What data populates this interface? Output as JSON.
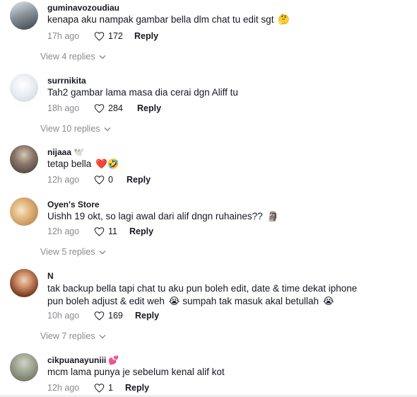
{
  "comments": [
    {
      "username": "guminavozoudiau",
      "username_emoji": "",
      "text": "kenapa aku nampak gambar bella dlm chat tu edit sgt",
      "text_emoji": "🤔",
      "time": "17h ago",
      "likes": "172",
      "reply_label": "Reply",
      "view_replies": "View 4 replies"
    },
    {
      "username": "surrnikita",
      "username_emoji": "",
      "text": "Tah2 gambar lama masa dia cerai dgn Aliff tu",
      "text_emoji": "",
      "time": "18h ago",
      "likes": "284",
      "reply_label": "Reply",
      "view_replies": "View 10 replies"
    },
    {
      "username": "nijaaa",
      "username_emoji": "🕊️",
      "text": "tetap bella",
      "text_emoji": "❤️🤣",
      "time": "12h ago",
      "likes": "0",
      "reply_label": "Reply",
      "view_replies": ""
    },
    {
      "username": "Oyen's Store",
      "username_emoji": "",
      "text": "Uishh 19 okt, so lagi awal dari alif dngn ruhaines??",
      "text_emoji": "🗿",
      "time": "12h ago",
      "likes": "11",
      "reply_label": "Reply",
      "view_replies": "View 5 replies"
    },
    {
      "username": "N",
      "username_emoji": "",
      "text_line1": "tak backup bella tapi chat tu aku pun boleh edit, date & time dekat iphone",
      "text_line2": "pun boleh adjust & edit weh",
      "text_emoji_a": "😭",
      "text_line2b": "sumpah tak masuk akal betullah",
      "text_emoji_b": "😭",
      "time": "10h ago",
      "likes": "169",
      "reply_label": "Reply",
      "view_replies": "View 7 replies"
    },
    {
      "username": "cikpuanayuniii",
      "username_emoji": "💕",
      "text": "mcm lama punya je sebelum kenal alif kot",
      "text_emoji": "",
      "time": "12h ago",
      "likes": "1",
      "reply_label": "Reply",
      "view_replies": ""
    }
  ],
  "icons": {
    "like": "heart-outline-icon",
    "expand": "chevron-down-icon"
  },
  "colors": {
    "text": "#161823",
    "secondary": "#8a8b91"
  }
}
